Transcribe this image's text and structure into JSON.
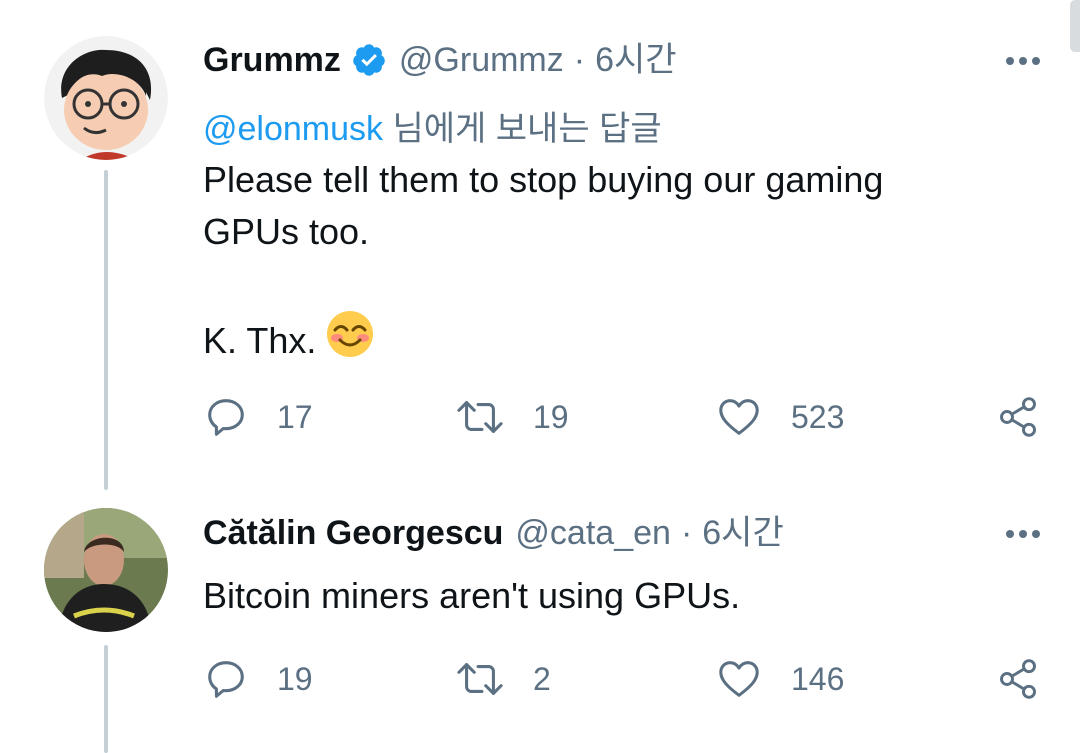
{
  "tweets": [
    {
      "name": "Grummz",
      "verified": true,
      "handle": "@Grummz",
      "dot": "·",
      "time": "6시간",
      "reply_to": {
        "mention": "@elonmusk",
        "suffix": " 님에게 보내는 답글"
      },
      "text_line1": "Please tell them to stop buying our gaming",
      "text_line2": "GPUs too.",
      "text_line3": "K. Thx.",
      "emoji": "smiling-face-with-smiling-eyes",
      "replies": "17",
      "retweets": "19",
      "likes": "523"
    },
    {
      "name": "Cătălin Georgescu",
      "verified": false,
      "handle": "@cata_en",
      "dot": "·",
      "time": "6시간",
      "text_line1": "Bitcoin miners aren't using GPUs.",
      "replies": "19",
      "retweets": "2",
      "likes": "146"
    }
  ],
  "colors": {
    "text": "#0f1419",
    "secondary": "#5b7083",
    "accent": "#1d9bf0",
    "thread_line": "#c4cfd6"
  }
}
